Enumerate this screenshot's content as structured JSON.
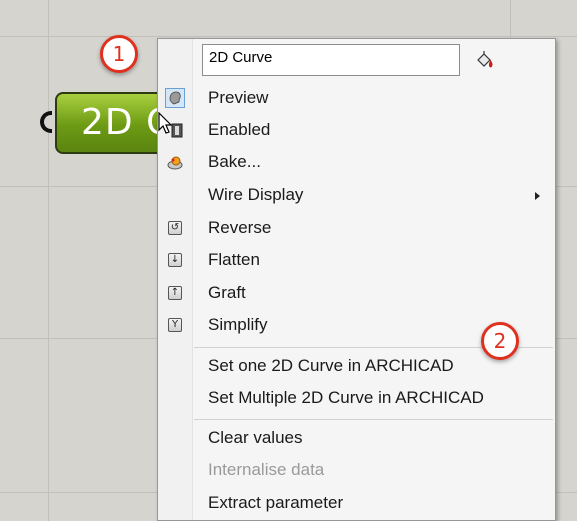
{
  "callouts": {
    "one": "1",
    "two": "2"
  },
  "node": {
    "label": "2D Curve",
    "color": "#6c9a14"
  },
  "menu": {
    "name_value": "2D Curve",
    "items": [
      {
        "label": "Preview",
        "icon": "preview-icon"
      },
      {
        "label": "Enabled",
        "icon": "enabled-icon"
      },
      {
        "label": "Bake...",
        "icon": "bake-icon"
      },
      {
        "label": "Wire Display",
        "icon": "",
        "submenu": true
      },
      {
        "label": "Reverse",
        "icon": "reverse-icon"
      },
      {
        "label": "Flatten",
        "icon": "flatten-icon"
      },
      {
        "label": "Graft",
        "icon": "graft-icon"
      },
      {
        "label": "Simplify",
        "icon": "simplify-icon"
      },
      {
        "label": "Set one 2D Curve in ARCHICAD"
      },
      {
        "label": "Set Multiple 2D Curve in ARCHICAD"
      },
      {
        "label": "Clear values"
      },
      {
        "label": "Internalise data",
        "disabled": true
      },
      {
        "label": "Extract parameter"
      }
    ]
  },
  "colors": {
    "accent_red": "#e0311f",
    "canvas": "#d6d4cf"
  }
}
